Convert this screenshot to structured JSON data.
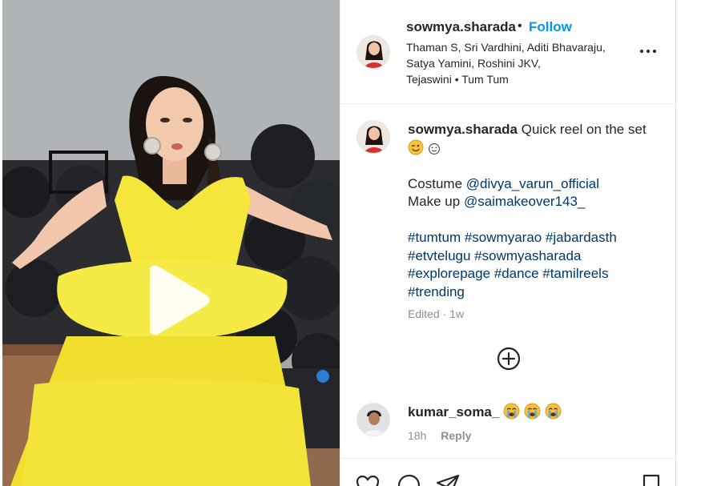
{
  "post": {
    "author": "sowmya.sharada",
    "separator": "•",
    "follow_label": "Follow",
    "tagged_line_1": "Thaman S, Sri Vardhini, Aditi Bhavaraju,",
    "tagged_line_2": "Satya Yamini, Roshini JKV,",
    "tagged_line_3": "Tejaswini • Tum Tum",
    "more_icon": "more-horizontal-icon"
  },
  "caption": {
    "author": "sowmya.sharada",
    "text_1": "Quick reel on the set",
    "emojis": [
      "winking-face-emoji",
      "smiling-face-emoji"
    ],
    "costume_label": "Costume",
    "costume_handle": "@divya_varun_official",
    "makeup_label": "Make up",
    "makeup_handle": "@saimakeover143_",
    "hashtags_line_1": "#tumtum #sowmyarao #jabardasth",
    "hashtags_line_2": "#etvtelugu #sowmyasharada",
    "hashtags_line_3": "#explorepage #dance #tamilreels",
    "hashtags_line_4": "#trending",
    "edited": "Edited",
    "dot": "·",
    "age": "1w"
  },
  "comments": [
    {
      "author": "kumar_soma_",
      "emojis": [
        "crying-face-emoji",
        "crying-face-emoji",
        "crying-face-emoji"
      ],
      "age": "18h",
      "reply_label": "Reply"
    }
  ],
  "icons": {
    "play": "play-icon",
    "load_more": "plus-circle-icon",
    "like": "heart-icon",
    "comment": "comment-icon",
    "share": "send-icon",
    "save": "bookmark-icon"
  },
  "colors": {
    "follow_blue": "#0095f6",
    "link_blue": "#00376b",
    "muted_gray": "#8e8e8e",
    "dress_yellow": "#f2e23a"
  }
}
